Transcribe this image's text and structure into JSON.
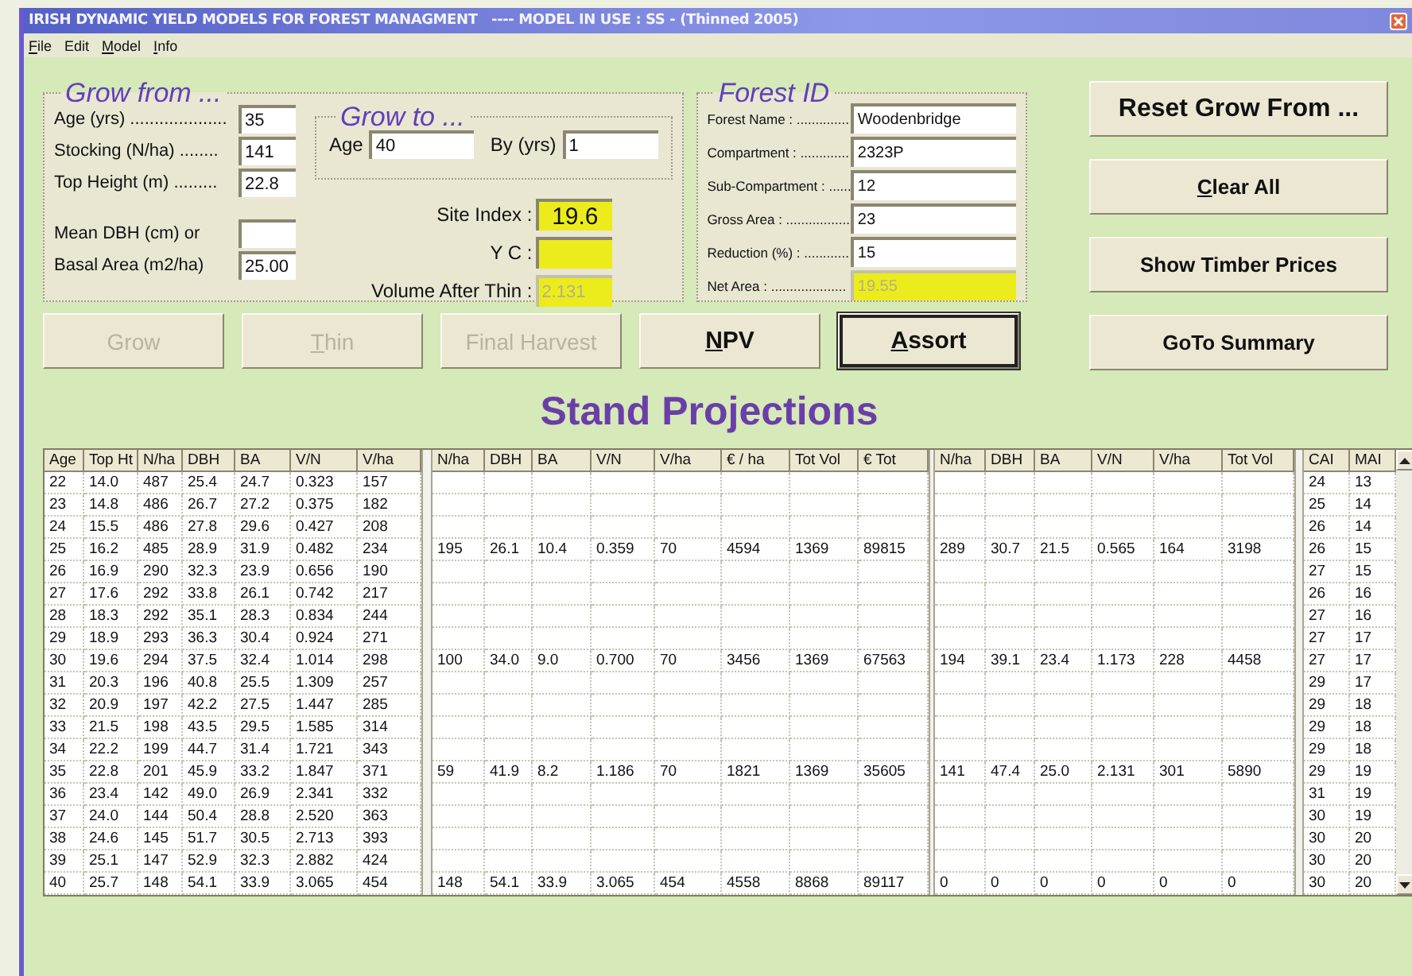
{
  "window": {
    "title": "IRISH DYNAMIC YIELD MODELS FOR FOREST MANAGMENT   ---- MODEL IN USE : SS - (Thinned 2005)"
  },
  "menu": [
    {
      "label": "File",
      "access_key": true
    },
    {
      "label": "Edit",
      "access_key": false
    },
    {
      "label": "Model",
      "access_key": true
    },
    {
      "label": "Info",
      "access_key": true
    }
  ],
  "grow_from": {
    "title": "Grow from ...",
    "fields": [
      {
        "label": "Age (yrs) ....................",
        "value": "35"
      },
      {
        "label": "Stocking (N/ha) ........",
        "value": "141"
      },
      {
        "label": "Top Height (m) .........",
        "value": "22.8"
      },
      {
        "label": "Mean DBH (cm) or"
      },
      {
        "label": "Basal Area (m2/ha)",
        "value": "25.00"
      }
    ]
  },
  "grow_to": {
    "title": "Grow to ...",
    "fields": [
      {
        "label": "Age",
        "value": "40"
      },
      {
        "label": "By (yrs)",
        "value": "1"
      }
    ]
  },
  "indices": [
    {
      "label": "Site Index :",
      "value": "19.6",
      "disabled": false
    },
    {
      "label": "Y C :",
      "disabled": false
    },
    {
      "label": "Volume After Thin :",
      "value": "2.131",
      "disabled": true
    }
  ],
  "forest_id": {
    "title": "Forest ID",
    "fields": [
      {
        "label": "Forest Name : ..............",
        "value": "Woodenbridge",
        "readonly": false
      },
      {
        "label": "Compartment : .............",
        "value": "2323P",
        "readonly": false
      },
      {
        "label": "Sub-Compartment : ......",
        "value": "12",
        "readonly": false
      },
      {
        "label": "Gross Area : .................",
        "value": "23",
        "readonly": false
      },
      {
        "label": "Reduction (%) : ............",
        "value": "15",
        "readonly": false
      },
      {
        "label": "Net Area : ....................",
        "value": "19.55",
        "readonly": true
      }
    ]
  },
  "action_buttons": [
    {
      "label": "Grow",
      "access_key": false,
      "disabled": true,
      "focused": false
    },
    {
      "label": "Thin",
      "access_key": true,
      "disabled": true,
      "focused": false
    },
    {
      "label": "Final Harvest",
      "access_key": false,
      "disabled": true,
      "focused": false
    },
    {
      "label": "NPV",
      "access_key": true,
      "disabled": false,
      "focused": false
    },
    {
      "label": "Assort",
      "access_key": true,
      "disabled": false,
      "focused": true
    }
  ],
  "side_buttons": [
    {
      "label": "Reset Grow From ...",
      "access_key": false
    },
    {
      "label": "Clear All",
      "access_key": true
    },
    {
      "label": "Show Timber Prices",
      "access_key": false
    },
    {
      "label": "GoTo Summary",
      "access_key": false
    }
  ],
  "heading": "Stand Projections",
  "table": {
    "columns": {
      "growth": [
        "Age",
        "Top Ht",
        "N/ha",
        "DBH",
        "BA",
        "V/N",
        "V/ha"
      ],
      "thinning": [
        "N/ha",
        "DBH",
        "BA",
        "V/N",
        "V/ha",
        "€ / ha",
        "Tot Vol",
        "€ Tot"
      ],
      "residual": [
        "N/ha",
        "DBH",
        "BA",
        "V/N",
        "V/ha",
        "Tot Vol"
      ],
      "increment": [
        "CAI",
        "MAI"
      ]
    },
    "rows": [
      {
        "growth": [
          "22",
          "14.0",
          "487",
          "25.4",
          "24.7",
          "0.323",
          "157"
        ],
        "increment": [
          "24",
          "13"
        ]
      },
      {
        "growth": [
          "23",
          "14.8",
          "486",
          "26.7",
          "27.2",
          "0.375",
          "182"
        ],
        "increment": [
          "25",
          "14"
        ]
      },
      {
        "growth": [
          "24",
          "15.5",
          "486",
          "27.8",
          "29.6",
          "0.427",
          "208"
        ],
        "increment": [
          "26",
          "14"
        ]
      },
      {
        "growth": [
          "25",
          "16.2",
          "485",
          "28.9",
          "31.9",
          "0.482",
          "234"
        ],
        "thinning": [
          "195",
          "26.1",
          "10.4",
          "0.359",
          "70",
          "4594",
          "1369",
          "89815"
        ],
        "residual": [
          "289",
          "30.7",
          "21.5",
          "0.565",
          "164",
          "3198"
        ],
        "increment": [
          "26",
          "15"
        ]
      },
      {
        "growth": [
          "26",
          "16.9",
          "290",
          "32.3",
          "23.9",
          "0.656",
          "190"
        ],
        "increment": [
          "27",
          "15"
        ]
      },
      {
        "growth": [
          "27",
          "17.6",
          "292",
          "33.8",
          "26.1",
          "0.742",
          "217"
        ],
        "increment": [
          "26",
          "16"
        ]
      },
      {
        "growth": [
          "28",
          "18.3",
          "292",
          "35.1",
          "28.3",
          "0.834",
          "244"
        ],
        "increment": [
          "27",
          "16"
        ]
      },
      {
        "growth": [
          "29",
          "18.9",
          "293",
          "36.3",
          "30.4",
          "0.924",
          "271"
        ],
        "increment": [
          "27",
          "17"
        ]
      },
      {
        "growth": [
          "30",
          "19.6",
          "294",
          "37.5",
          "32.4",
          "1.014",
          "298"
        ],
        "thinning": [
          "100",
          "34.0",
          "9.0",
          "0.700",
          "70",
          "3456",
          "1369",
          "67563"
        ],
        "residual": [
          "194",
          "39.1",
          "23.4",
          "1.173",
          "228",
          "4458"
        ],
        "increment": [
          "27",
          "17"
        ]
      },
      {
        "growth": [
          "31",
          "20.3",
          "196",
          "40.8",
          "25.5",
          "1.309",
          "257"
        ],
        "increment": [
          "29",
          "17"
        ]
      },
      {
        "growth": [
          "32",
          "20.9",
          "197",
          "42.2",
          "27.5",
          "1.447",
          "285"
        ],
        "increment": [
          "29",
          "18"
        ]
      },
      {
        "growth": [
          "33",
          "21.5",
          "198",
          "43.5",
          "29.5",
          "1.585",
          "314"
        ],
        "increment": [
          "29",
          "18"
        ]
      },
      {
        "growth": [
          "34",
          "22.2",
          "199",
          "44.7",
          "31.4",
          "1.721",
          "343"
        ],
        "increment": [
          "29",
          "18"
        ]
      },
      {
        "growth": [
          "35",
          "22.8",
          "201",
          "45.9",
          "33.2",
          "1.847",
          "371"
        ],
        "thinning": [
          "59",
          "41.9",
          "8.2",
          "1.186",
          "70",
          "1821",
          "1369",
          "35605"
        ],
        "residual": [
          "141",
          "47.4",
          "25.0",
          "2.131",
          "301",
          "5890"
        ],
        "increment": [
          "29",
          "19"
        ]
      },
      {
        "growth": [
          "36",
          "23.4",
          "142",
          "49.0",
          "26.9",
          "2.341",
          "332"
        ],
        "increment": [
          "31",
          "19"
        ]
      },
      {
        "growth": [
          "37",
          "24.0",
          "144",
          "50.4",
          "28.8",
          "2.520",
          "363"
        ],
        "increment": [
          "30",
          "19"
        ]
      },
      {
        "growth": [
          "38",
          "24.6",
          "145",
          "51.7",
          "30.5",
          "2.713",
          "393"
        ],
        "increment": [
          "30",
          "20"
        ]
      },
      {
        "growth": [
          "39",
          "25.1",
          "147",
          "52.9",
          "32.3",
          "2.882",
          "424"
        ],
        "increment": [
          "30",
          "20"
        ]
      },
      {
        "growth": [
          "40",
          "25.7",
          "148",
          "54.1",
          "33.9",
          "3.065",
          "454"
        ],
        "thinning": [
          "148",
          "54.1",
          "33.9",
          "3.065",
          "454",
          "4558",
          "8868",
          "89117"
        ],
        "residual": [
          "0",
          "0",
          "0",
          "0",
          "0",
          "0"
        ],
        "increment": [
          "30",
          "20"
        ]
      }
    ]
  }
}
